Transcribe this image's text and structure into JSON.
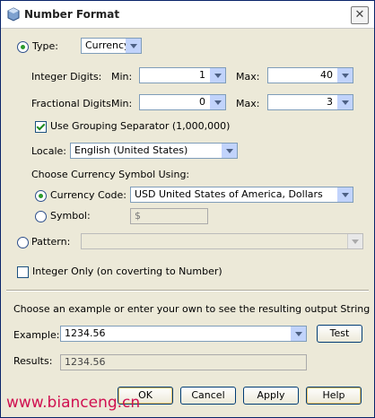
{
  "window": {
    "title": "Number Format"
  },
  "type": {
    "label": "Type:",
    "selected": "Currency"
  },
  "integer_digits": {
    "label": "Integer Digits:",
    "min_label": "Min:",
    "min_value": "1",
    "max_label": "Max:",
    "max_value": "40"
  },
  "fractional_digits": {
    "label": "Fractional Digits:",
    "min_label": "Min:",
    "min_value": "0",
    "max_label": "Max:",
    "max_value": "3"
  },
  "grouping": {
    "label": "Use Grouping Separator (1,000,000)"
  },
  "locale": {
    "label": "Locale:",
    "selected": "English (United States)"
  },
  "currency_symbol": {
    "heading": "Choose Currency Symbol Using:",
    "code_label": "Currency Code:",
    "code_selected": "USD United States of America, Dollars",
    "symbol_label": "Symbol:",
    "symbol_value": "$"
  },
  "pattern": {
    "label": "Pattern:",
    "value": ""
  },
  "integer_only": {
    "label": "Integer Only (on coverting to Number)"
  },
  "example_section": {
    "hint": "Choose an example or enter your own to see the resulting output String",
    "example_label": "Example:",
    "example_value": "1234.56",
    "test_label": "Test",
    "results_label": "Results:",
    "results_value": "1234.56"
  },
  "buttons": {
    "ok": "OK",
    "cancel": "Cancel",
    "apply": "Apply",
    "help": "Help"
  },
  "watermark": "www.bianceng.cn",
  "colors": {
    "accent": "#2b9a2b",
    "border": "#7f9db9",
    "watermark": "#d01050"
  }
}
